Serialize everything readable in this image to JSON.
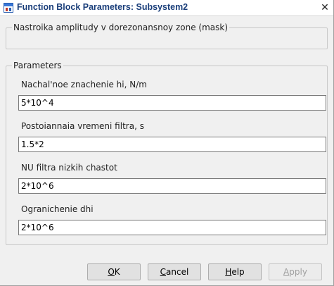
{
  "window": {
    "title": "Function Block Parameters: Subsystem2",
    "close_glyph": "✕"
  },
  "mask": {
    "legend": "Nastroika amplitudy v dorezonansnoy zone (mask)"
  },
  "parameters": {
    "legend": "Parameters",
    "fields": [
      {
        "label": "Nachal'noe znachenie hi, N/m",
        "value": "5*10^4"
      },
      {
        "label": "Postoiannaia vremeni filtra, s",
        "value": "1.5*2"
      },
      {
        "label": "NU filtra nizkih chastot",
        "value": "2*10^6"
      },
      {
        "label": "Ogranichenie dhi",
        "value": "2*10^6"
      }
    ]
  },
  "buttons": {
    "ok": {
      "mnemonic": "O",
      "rest": "K"
    },
    "cancel": {
      "mnemonic": "C",
      "rest": "ancel"
    },
    "help": {
      "mnemonic": "H",
      "rest": "elp"
    },
    "apply": {
      "mnemonic": "A",
      "rest": "pply",
      "disabled": true
    }
  },
  "icons": {
    "app": "simulink-block-icon",
    "close": "close-icon"
  }
}
